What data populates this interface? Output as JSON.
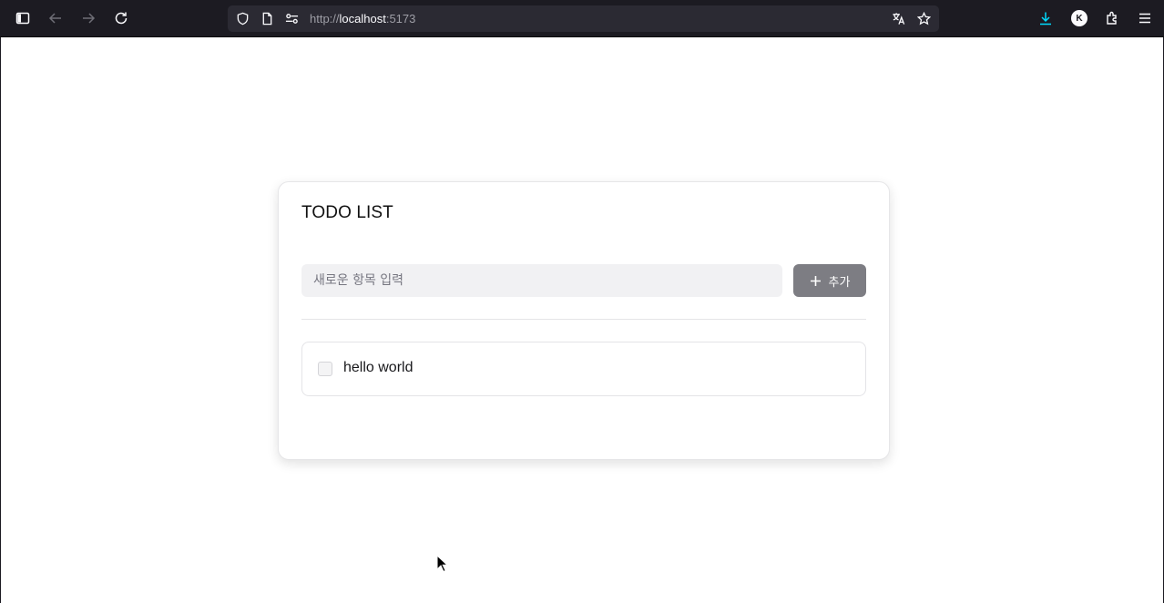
{
  "browser": {
    "url_scheme": "http://",
    "url_host": "localhost",
    "url_port": ":5173",
    "profile_initial": "K",
    "download_color": "#00ddff"
  },
  "app": {
    "title": "TODO LIST",
    "input_placeholder": "새로운 항목 입력",
    "input_value": "",
    "add_label": "추가",
    "button_color": "#7d7d83",
    "todos": [
      {
        "text": "hello world",
        "done": false
      }
    ]
  }
}
